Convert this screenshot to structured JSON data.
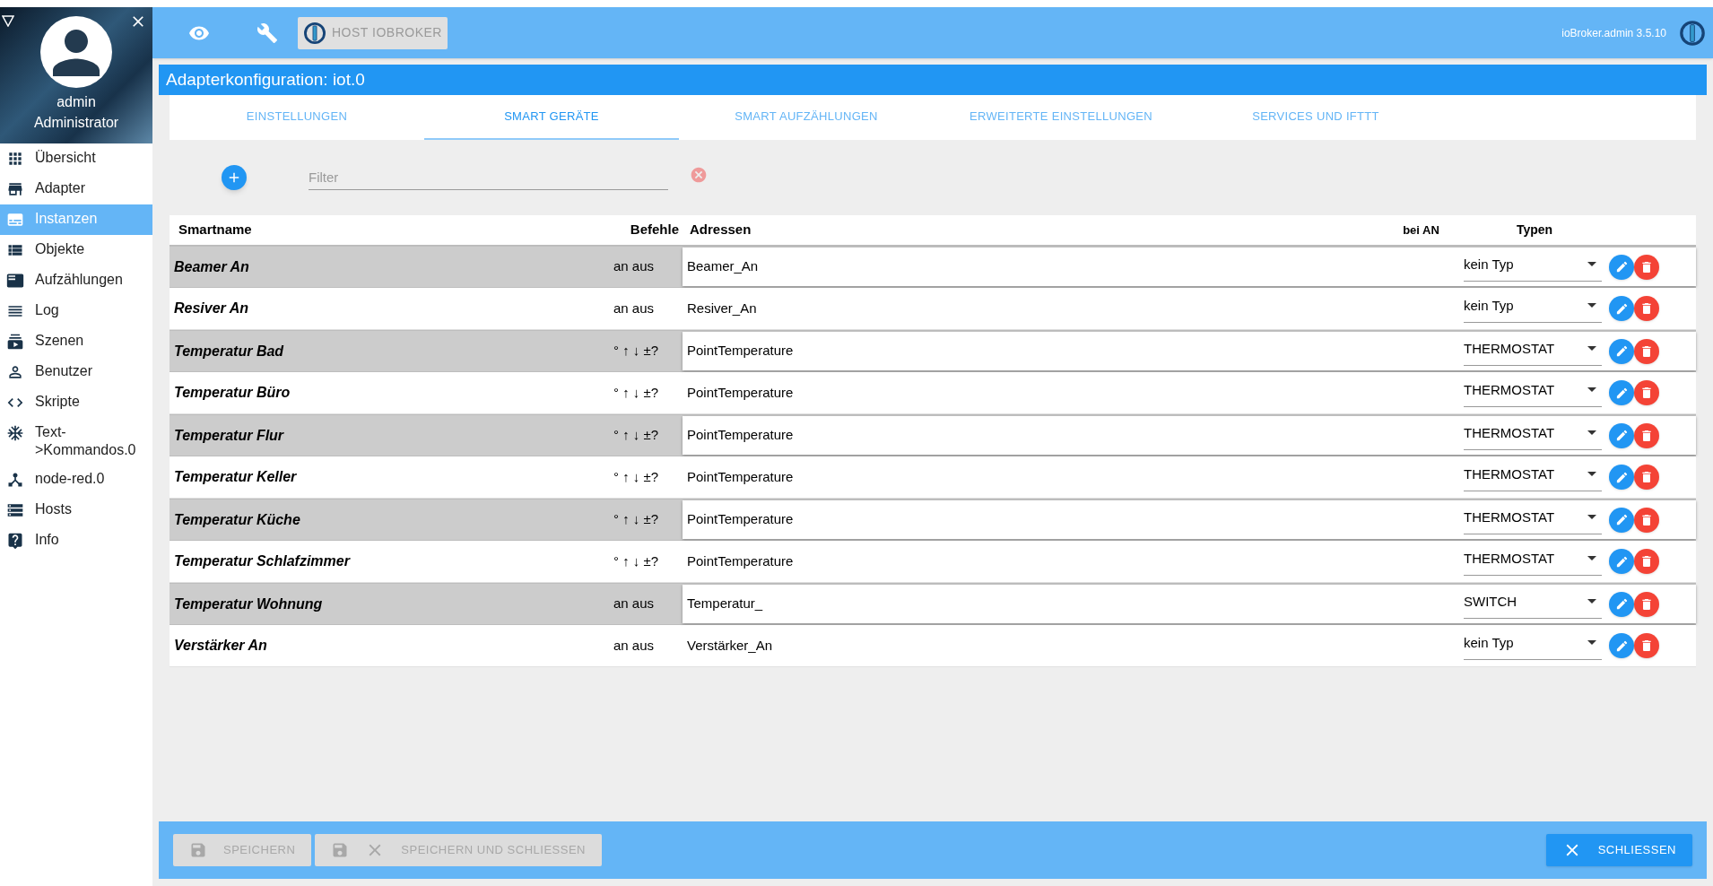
{
  "sidebar": {
    "user": {
      "name": "admin",
      "role": "Administrator"
    },
    "items": [
      {
        "label": "Übersicht",
        "selected": false
      },
      {
        "label": "Adapter",
        "selected": false
      },
      {
        "label": "Instanzen",
        "selected": true
      },
      {
        "label": "Objekte",
        "selected": false
      },
      {
        "label": "Aufzählungen",
        "selected": false
      },
      {
        "label": "Log",
        "selected": false
      },
      {
        "label": "Szenen",
        "selected": false
      },
      {
        "label": "Benutzer",
        "selected": false
      },
      {
        "label": "Skripte",
        "selected": false
      },
      {
        "label": "Text->Kommandos.0",
        "selected": false
      },
      {
        "label": "node-red.0",
        "selected": false
      },
      {
        "label": "Hosts",
        "selected": false
      },
      {
        "label": "Info",
        "selected": false
      }
    ]
  },
  "toolbar": {
    "host_button": "HOST IOBROKER",
    "version": "ioBroker.admin 3.5.10"
  },
  "dialog": {
    "title": "Adapterkonfiguration: iot.0",
    "tabs": [
      {
        "label": "EINSTELLUNGEN",
        "selected": false
      },
      {
        "label": "SMART GERÄTE",
        "selected": true
      },
      {
        "label": "SMART AUFZÄHLUNGEN",
        "selected": false
      },
      {
        "label": "ERWEITERTE EINSTELLUNGEN",
        "selected": false
      },
      {
        "label": "SERVICES UND IFTTT",
        "selected": false
      }
    ],
    "filter": {
      "placeholder": "Filter"
    },
    "table": {
      "columns": [
        "Smartname",
        "Befehle",
        "Adressen",
        "bei AN",
        "Typen"
      ],
      "rows": [
        {
          "smartname": "Beamer An",
          "commands": "an aus",
          "address": "Beamer_An",
          "type": "kein Typ"
        },
        {
          "smartname": "Resiver An",
          "commands": "an aus",
          "address": "Resiver_An",
          "type": "kein Typ"
        },
        {
          "smartname": "Temperatur Bad",
          "commands": "° ↑ ↓ ±?",
          "address": "PointTemperature",
          "type": "THERMOSTAT"
        },
        {
          "smartname": "Temperatur Büro",
          "commands": "° ↑ ↓ ±?",
          "address": "PointTemperature",
          "type": "THERMOSTAT"
        },
        {
          "smartname": "Temperatur Flur",
          "commands": "° ↑ ↓ ±?",
          "address": "PointTemperature",
          "type": "THERMOSTAT"
        },
        {
          "smartname": "Temperatur Keller",
          "commands": "° ↑ ↓ ±?",
          "address": "PointTemperature",
          "type": "THERMOSTAT"
        },
        {
          "smartname": "Temperatur Küche",
          "commands": "° ↑ ↓ ±?",
          "address": "PointTemperature",
          "type": "THERMOSTAT"
        },
        {
          "smartname": "Temperatur Schlafzimmer",
          "commands": "° ↑ ↓ ±?",
          "address": "PointTemperature",
          "type": "THERMOSTAT"
        },
        {
          "smartname": "Temperatur Wohnung",
          "commands": "an aus",
          "address": "Temperatur_",
          "type": "SWITCH"
        },
        {
          "smartname": "Verstärker An",
          "commands": "an aus",
          "address": "Verstärker_An",
          "type": "kein Typ"
        }
      ]
    },
    "buttons": [
      {
        "kind": "save",
        "label": "SPEICHERN",
        "disabled": true
      },
      {
        "kind": "save_close",
        "label": "SPEICHERN UND SCHLIESSEN",
        "disabled": true
      },
      {
        "kind": "close",
        "label": "SCHLIESSEN",
        "disabled": false
      }
    ]
  }
}
